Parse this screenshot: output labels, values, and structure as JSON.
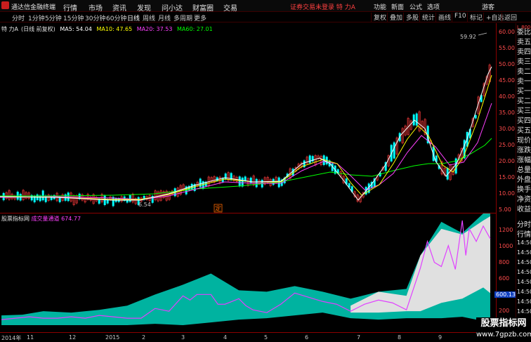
{
  "menubar": {
    "app_title": "通达信金融终端",
    "items": [
      "行情",
      "市场",
      "资讯",
      "发现",
      "问小达",
      "财富圈",
      "交易"
    ],
    "notice": "证券交易未登录  特 力A",
    "right_items": [
      "功能",
      "新面",
      "公式",
      "选项",
      "游客"
    ]
  },
  "periodbar": {
    "periods": [
      "分时",
      "1分钟",
      "5分钟",
      "15分钟",
      "30分钟",
      "60分钟",
      "日线",
      "周线",
      "月线",
      "多周期",
      "更多"
    ],
    "active_period": "日线",
    "tools": [
      "复权",
      "叠加",
      "多股",
      "统计",
      "画线",
      "F10",
      "标记",
      "+自选",
      "返回"
    ]
  },
  "chart": {
    "stock_name": "特 力A",
    "mode": "(日线 前复权)",
    "ma5_label": "MA5: 54.04",
    "ma10_label": "MA10: 47.65",
    "ma20_label": "MA20: 37.53",
    "ma60_label": "MA60: 27.01",
    "high_label": "59.92",
    "low_label": "6.54",
    "event_marker": "定",
    "colors": {
      "ma5": "#ffffff",
      "ma10": "#ffff00",
      "ma20": "#ff40ff",
      "ma60": "#00ff00",
      "up": "#ff3c3c",
      "down": "#00ffff",
      "axis": "#ff4b4b"
    },
    "price_ticks": [
      "60.00",
      "55.00",
      "50.00",
      "45.00",
      "40.00",
      "35.00",
      "30.00",
      "25.00",
      "20.00",
      "15.00",
      "10.00",
      "5.00"
    ]
  },
  "indicator": {
    "name": "股票指标网",
    "subtitle": "成交量通道",
    "value": "674.77",
    "current_value": "600.13",
    "ticks": [
      "1200",
      "1000",
      "800",
      "600",
      "400",
      "200"
    ],
    "colors": {
      "band_upper": "#00b3a0",
      "band_lower": "#e0e0e0",
      "line": "#e040ff"
    }
  },
  "timeaxis": {
    "labels": [
      "2014年",
      "11",
      "12",
      "2015",
      "2",
      "3",
      "4",
      "5",
      "6",
      "7",
      "8",
      "9"
    ]
  },
  "sidepanel": {
    "header": "L 800",
    "items": [
      "委比",
      "卖五",
      "卖四",
      "卖三",
      "卖二",
      "卖一",
      "买一",
      "买二",
      "买三",
      "买四",
      "买五",
      "现价",
      "涨跌",
      "涨幅",
      "总量",
      "外盘",
      "换手",
      "净资",
      "收益",
      "分时",
      "行情",
      "14:50",
      "14:50",
      "14:50",
      "14:50",
      "14:50",
      "14:50",
      "14:50",
      "14:50"
    ]
  },
  "watermark": {
    "title": "股票指标网",
    "url": "www.7gpzb.com"
  }
}
